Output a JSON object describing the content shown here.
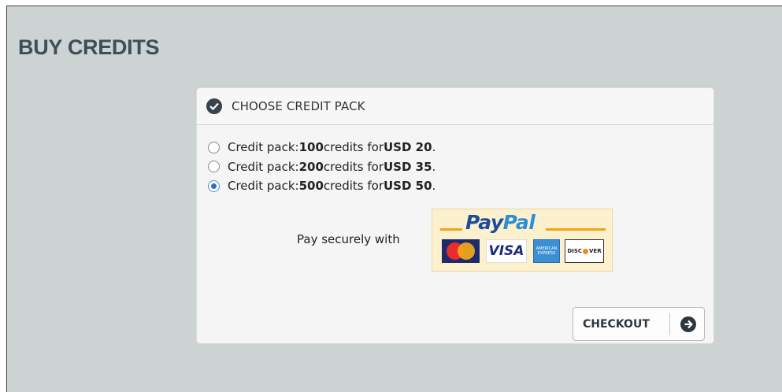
{
  "page": {
    "title": "BUY CREDITS"
  },
  "panel": {
    "header": "CHOOSE CREDIT PACK"
  },
  "options": [
    {
      "prefix": "Credit pack: ",
      "credits": "100",
      "mid": " credits for ",
      "price": "USD 20",
      "suffix": ".",
      "selected": false
    },
    {
      "prefix": "Credit pack: ",
      "credits": "200",
      "mid": " credits for ",
      "price": "USD 35",
      "suffix": ".",
      "selected": false
    },
    {
      "prefix": "Credit pack: ",
      "credits": "500",
      "mid": " credits for ",
      "price": "USD 50",
      "suffix": ".",
      "selected": true
    }
  ],
  "payment": {
    "label": "Pay securely with",
    "paypal_a": "Pay",
    "paypal_b": "Pal",
    "cards": [
      "MasterCard",
      "VISA",
      "AMERICAN EXPRESS",
      "DISCOVER"
    ]
  },
  "checkout": {
    "label": "CHECKOUT"
  },
  "icons": {
    "header": "check-circle-icon",
    "checkout": "arrow-right-circle-icon"
  },
  "colors": {
    "title": "#3e4e5c",
    "background": "#cdd2d2",
    "panel": "#f5f5f5",
    "radio_selected": "#2e6dd4"
  }
}
